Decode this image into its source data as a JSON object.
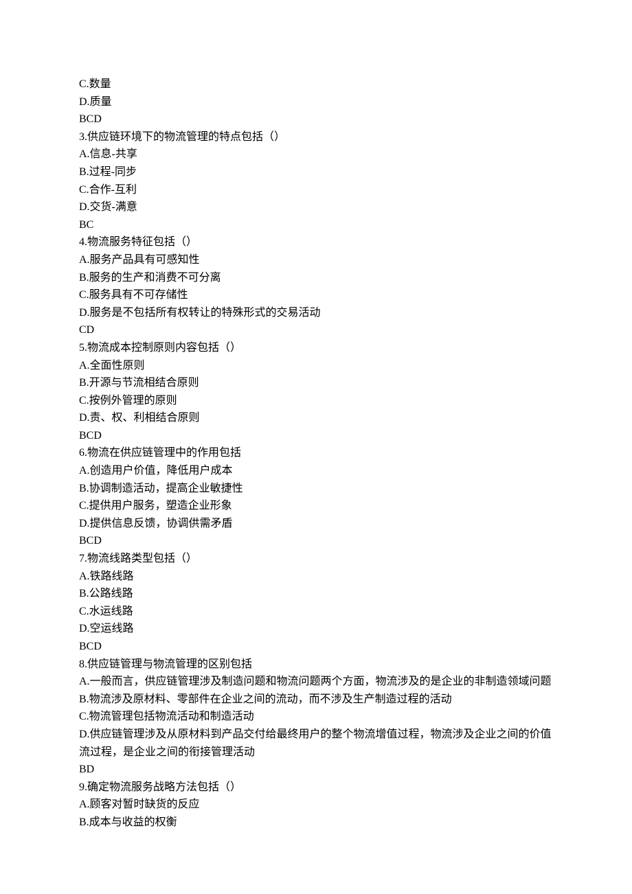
{
  "lines": [
    "C.数量",
    "D.质量",
    "BCD",
    "3.供应链环境下的物流管理的特点包括（）",
    "A.信息-共享",
    "B.过程-同步",
    "C.合作-互利",
    "D.交货-满意",
    "BC",
    "4.物流服务特征包括（）",
    "A.服务产品具有可感知性",
    "B.服务的生产和消费不可分离",
    "C.服务具有不可存储性",
    "D.服务是不包括所有权转让的特殊形式的交易活动",
    "CD",
    "5.物流成本控制原则内容包括（）",
    "A.全面性原则",
    "B.开源与节流相结合原则",
    "C.按例外管理的原则",
    "D.责、权、利相结合原则",
    "BCD",
    "6.物流在供应链管理中的作用包括",
    "A.创造用户价值，降低用户成本",
    "B.协调制造活动，提高企业敏捷性",
    "C.提供用户服务，塑造企业形象",
    "D.提供信息反馈，协调供需矛盾",
    "BCD",
    "7.物流线路类型包括（）",
    "A.铁路线路",
    "B.公路线路",
    "C.水运线路",
    "D.空运线路",
    "BCD",
    "8.供应链管理与物流管理的区别包括",
    "A.一般而言，供应链管理涉及制造问题和物流问题两个方面，物流涉及的是企业的非制造领域问题",
    "B.物流涉及原材料、零部件在企业之间的流动，而不涉及生产制造过程的活动",
    "C.物流管理包括物流活动和制造活动",
    "D.供应链管理涉及从原材料到产品交付给最终用户的整个物流增值过程，物流涉及企业之间的价值流过程，是企业之间的衔接管理活动",
    "BD",
    "9.确定物流服务战略方法包括（）",
    "A.顾客对暂时缺货的反应",
    "B.成本与收益的权衡"
  ]
}
